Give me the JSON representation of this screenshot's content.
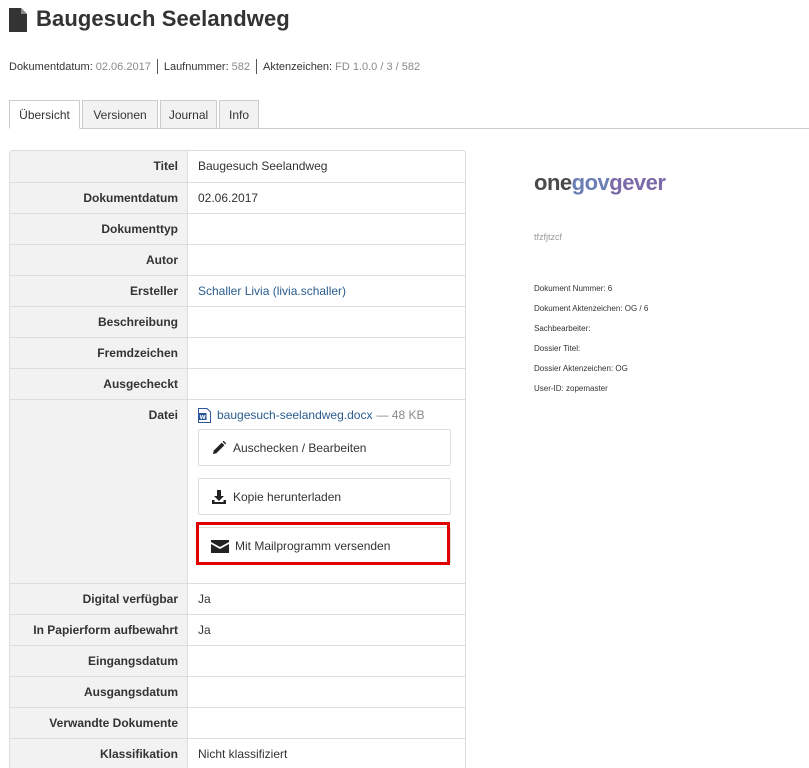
{
  "header": {
    "title": "Baugesuch Seelandweg"
  },
  "byline": {
    "date_label": "Dokumentdatum:",
    "date_value": "02.06.2017",
    "seq_label": "Laufnummer:",
    "seq_value": "582",
    "ref_label": "Aktenzeichen:",
    "ref_value": "FD 1.0.0 / 3 / 582"
  },
  "tabs": [
    {
      "label": "Übersicht",
      "active": true
    },
    {
      "label": "Versionen",
      "active": false
    },
    {
      "label": "Journal",
      "active": false
    },
    {
      "label": "Info",
      "active": false
    }
  ],
  "metadata": {
    "title": {
      "label": "Titel",
      "value": "Baugesuch Seelandweg"
    },
    "document_date": {
      "label": "Dokumentdatum",
      "value": "02.06.2017"
    },
    "document_type": {
      "label": "Dokumenttyp",
      "value": ""
    },
    "author": {
      "label": "Autor",
      "value": ""
    },
    "creator": {
      "label": "Ersteller",
      "value": "Schaller Livia (livia.schaller)"
    },
    "description": {
      "label": "Beschreibung",
      "value": ""
    },
    "foreign_reference": {
      "label": "Fremdzeichen",
      "value": ""
    },
    "checked_out": {
      "label": "Ausgecheckt",
      "value": ""
    },
    "file": {
      "label": "Datei",
      "filename": "baugesuch-seelandweg.docx",
      "size": "— 48 KB"
    },
    "digital_available": {
      "label": "Digital verfügbar",
      "value": "Ja"
    },
    "paper_stored": {
      "label": "In Papierform aufbewahrt",
      "value": "Ja"
    },
    "receipt_date": {
      "label": "Eingangsdatum",
      "value": ""
    },
    "delivery_date": {
      "label": "Ausgangsdatum",
      "value": ""
    },
    "related_documents": {
      "label": "Verwandte Dokumente",
      "value": ""
    },
    "classification": {
      "label": "Klassifikation",
      "value": "Nicht klassifiziert"
    }
  },
  "file_actions": {
    "checkout_label": "Auschecken / Bearbeiten",
    "download_label": "Kopie herunterladen",
    "mail_label": "Mit Mailprogramm versenden",
    "highlight_color": "#e00000"
  },
  "preview": {
    "logo_one": "one",
    "logo_gov": "gov",
    "logo_gever": "gever",
    "code": "tfzfjtzcf",
    "lines": [
      "Dokument Nummer: 6",
      "Dokument Aktenzeichen: OG / 6",
      "Sachbearbeiter:",
      "Dossier Titel:",
      "Dossier Aktenzeichen: OG",
      "User-ID: zopemaster"
    ]
  },
  "icons": [
    "document-icon",
    "word-file-icon",
    "pencil-icon",
    "download-icon",
    "envelope-icon"
  ],
  "colors": {
    "link": "#2a5d8f",
    "muted": "#8a8a8a",
    "label_bg": "#f2f2f2"
  }
}
